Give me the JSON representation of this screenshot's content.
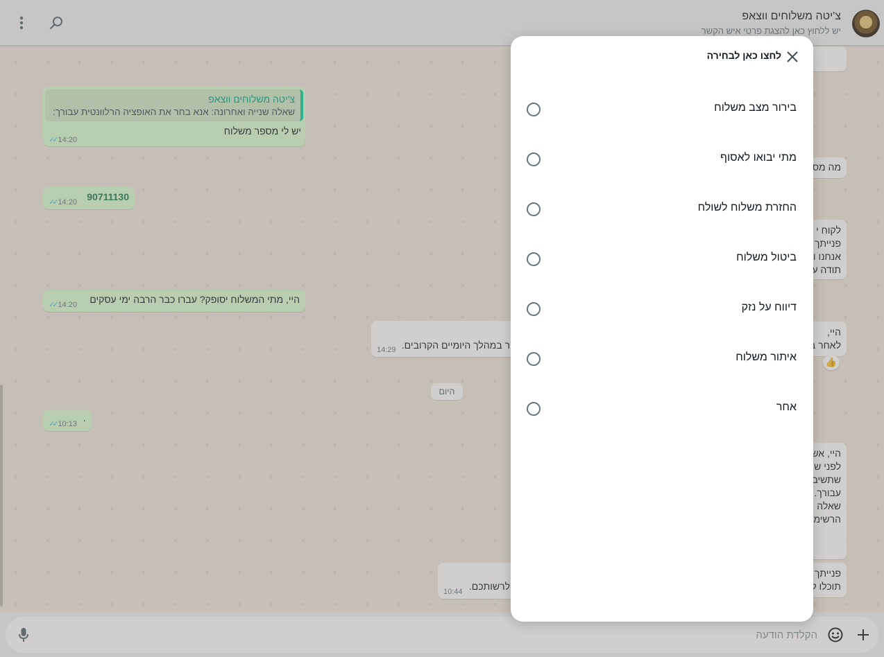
{
  "header": {
    "title": "צ'יטה משלוחים ווצאפ",
    "subtitle": "יש ללחוץ כאן להצגת פרטי איש הקשר"
  },
  "messages": {
    "m1": {
      "quote_name": "צ'יטה משלוחים ווצאפ",
      "quote_text": "שאלה שנייה ואחרונה: אנא בחר את האופציה הרלוונטית עבורך:",
      "text": "יש לי מספר משלוח",
      "time": "14:20"
    },
    "m2": {
      "text": "90711130",
      "time": "14:20"
    },
    "m3": {
      "text": "היי, מתי המשלוח יסופק? עברו כבר הרבה ימי עסקים",
      "time": "14:20"
    },
    "m4": {
      "text": "ר במהלך היומיים הקרובים.",
      "time": "14:29"
    },
    "m5": {
      "text": "·",
      "time": "10:13"
    },
    "m6": {
      "text": "לרשותכם.",
      "time": "10:44"
    }
  },
  "incoming_partial": {
    "p1": "מה מס",
    "p2": [
      "לקוח י",
      "פנייתך",
      "אנחנו ו",
      "תודה ע"
    ],
    "p3": [
      "היי,",
      "לאחר ב"
    ],
    "p4": [
      "היי, אש",
      "לפני ש",
      "שתשיב",
      "עבורך.",
      "שאלה",
      "הרשימ"
    ],
    "p5": [
      "פנייתך",
      "תוכלו ל"
    ]
  },
  "reaction_emoji": "👍",
  "date_chip": "היום",
  "composer": {
    "placeholder": "הקלדת הודעה"
  },
  "modal": {
    "title": "לחצו כאן לבחירה",
    "options": [
      {
        "label": "בירור מצב משלוח"
      },
      {
        "label": "מתי יבואו לאסוף"
      },
      {
        "label": "החזרת משלוח לשולח"
      },
      {
        "label": "ביטול משלוח"
      },
      {
        "label": "דיווח על נזק"
      },
      {
        "label": "איתור משלוח"
      },
      {
        "label": "אחר"
      }
    ]
  },
  "icons": {
    "menu": "kebab-menu-icon",
    "search": "search-icon",
    "close": "close-icon",
    "plus": "plus-icon",
    "emoji": "emoji-icon",
    "mic": "microphone-icon"
  },
  "colors": {
    "outgoing_bubble": "#d9fdd3",
    "incoming_bubble": "#ffffff",
    "accent": "#06cf9c",
    "chat_background": "#efe7dd"
  }
}
